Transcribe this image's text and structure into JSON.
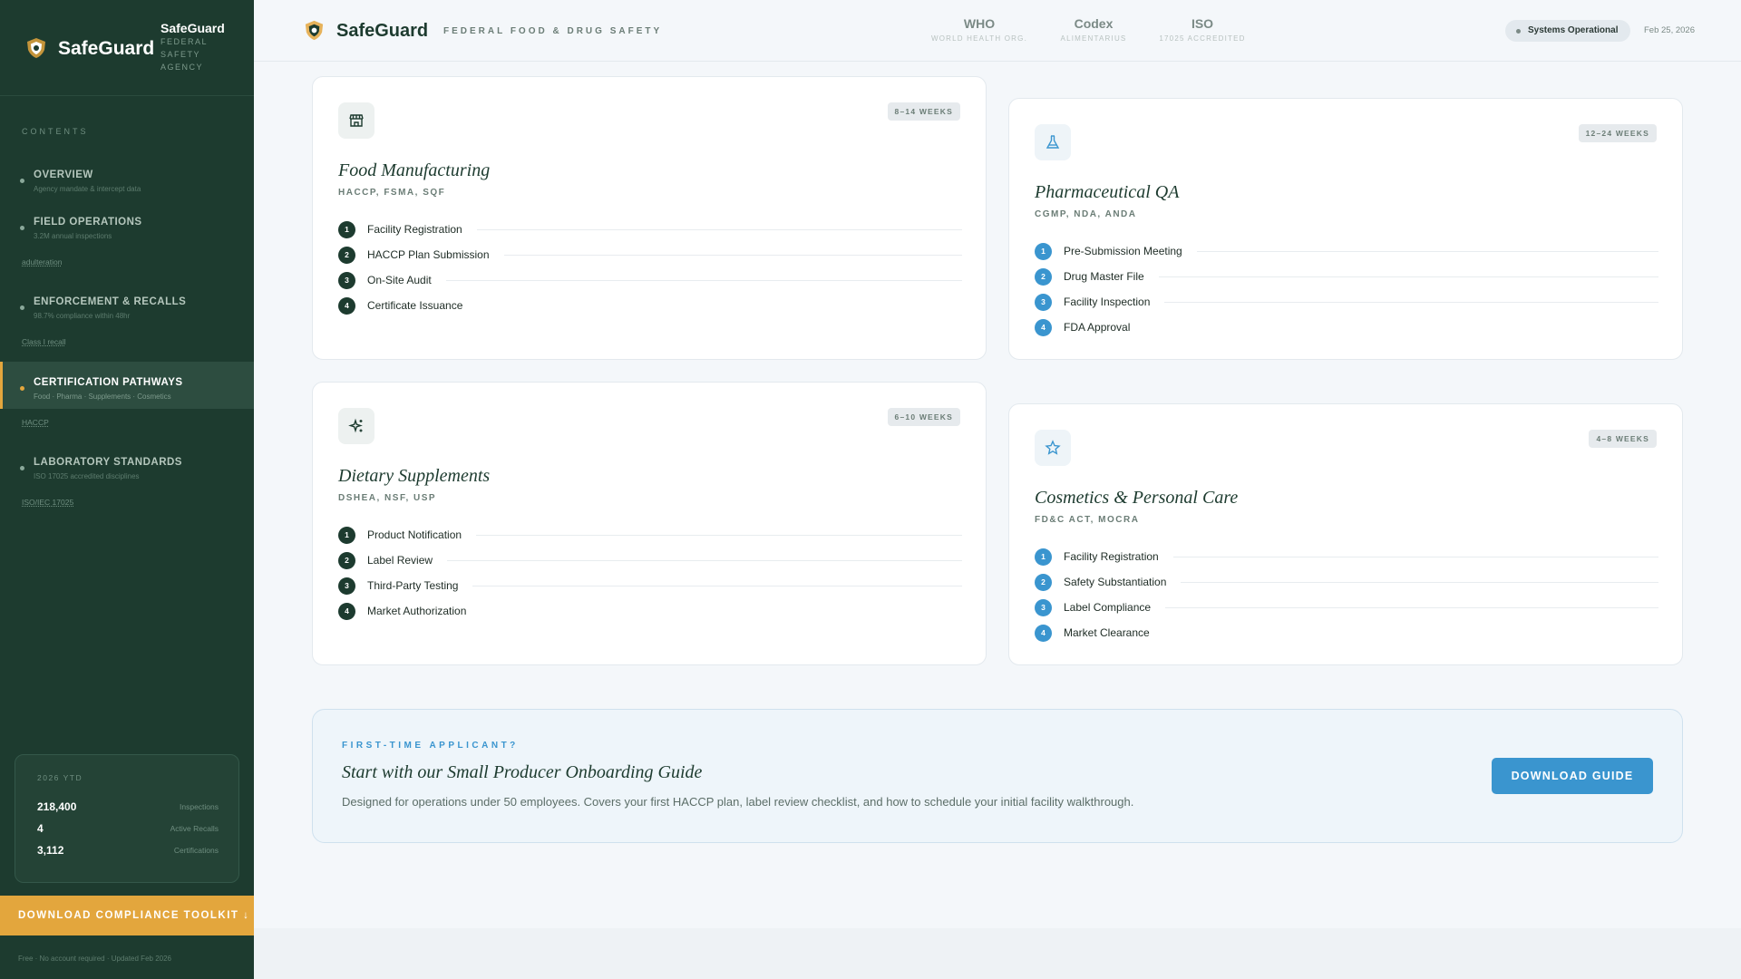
{
  "sidebar": {
    "brand_name": "SafeGuard",
    "brand_sub_title": "SafeGuard",
    "brand_sub_lines": [
      "FEDERAL",
      "SAFETY",
      "AGENCY"
    ],
    "contents_label": "CONTENTS",
    "items": [
      {
        "title": "OVERVIEW",
        "desc": "Agency mandate & intercept data",
        "tag": ""
      },
      {
        "title": "FIELD OPERATIONS",
        "desc": "3.2M annual inspections",
        "tag": "adulteration"
      },
      {
        "title": "ENFORCEMENT & RECALLS",
        "desc": "98.7% compliance within 48hr",
        "tag": "Class I recall"
      },
      {
        "title": "CERTIFICATION PATHWAYS",
        "desc": "Food · Pharma · Supplements · Cosmetics",
        "tag": "HACCP"
      },
      {
        "title": "LABORATORY STANDARDS",
        "desc": "ISO 17025 accredited disciplines",
        "tag": "ISO/IEC 17025"
      }
    ],
    "stats": {
      "label": "2026 YTD",
      "rows": [
        {
          "value": "218,400",
          "name": "Inspections"
        },
        {
          "value": "4",
          "name": "Active Recalls"
        },
        {
          "value": "3,112",
          "name": "Certifications"
        }
      ]
    },
    "toolkit_button": "DOWNLOAD COMPLIANCE TOOLKIT ↓",
    "toolkit_note": "Free · No account required · Updated Feb 2026"
  },
  "header": {
    "brand": "SafeGuard",
    "tagline": "FEDERAL FOOD & DRUG SAFETY",
    "standards": [
      {
        "name": "WHO",
        "sub": "WORLD HEALTH ORG."
      },
      {
        "name": "Codex",
        "sub": "ALIMENTARIUS"
      },
      {
        "name": "ISO",
        "sub": "17025 ACCREDITED"
      }
    ],
    "status": "Systems Operational",
    "date": "Feb 25, 2026"
  },
  "cards": [
    {
      "badge": "8–14 WEEKS",
      "title": "Food Manufacturing",
      "standards": "HACCP, FSMA, SQF",
      "icon": "store-icon",
      "steps": [
        "Facility Registration",
        "HACCP Plan Submission",
        "On-Site Audit",
        "Certificate Issuance"
      ]
    },
    {
      "badge": "12–24 WEEKS",
      "title": "Pharmaceutical QA",
      "standards": "CGMP, NDA, ANDA",
      "icon": "flask-icon",
      "steps": [
        "Pre-Submission Meeting",
        "Drug Master File",
        "Facility Inspection",
        "FDA Approval"
      ]
    },
    {
      "badge": "6–10 WEEKS",
      "title": "Dietary Supplements",
      "standards": "DSHEA, NSF, USP",
      "icon": "sparkle-icon",
      "steps": [
        "Product Notification",
        "Label Review",
        "Third-Party Testing",
        "Market Authorization"
      ]
    },
    {
      "badge": "4–8 WEEKS",
      "title": "Cosmetics & Personal Care",
      "standards": "FD&C ACT, MOCRA",
      "icon": "star-icon",
      "steps": [
        "Facility Registration",
        "Safety Substantiation",
        "Label Compliance",
        "Market Clearance"
      ]
    }
  ],
  "onboarding": {
    "eyebrow": "FIRST-TIME APPLICANT?",
    "title": "Start with our Small Producer Onboarding Guide",
    "desc": "Designed for operations under 50 employees. Covers your first HACCP plan, label review checklist, and how to schedule your initial facility walkthrough.",
    "button": "DOWNLOAD GUIDE"
  },
  "step_numbers": [
    "1",
    "2",
    "3",
    "4"
  ],
  "colors": {
    "sidebar": "#1d3b2f",
    "accent": "#e3a63d",
    "blue": "#3a95cf"
  }
}
